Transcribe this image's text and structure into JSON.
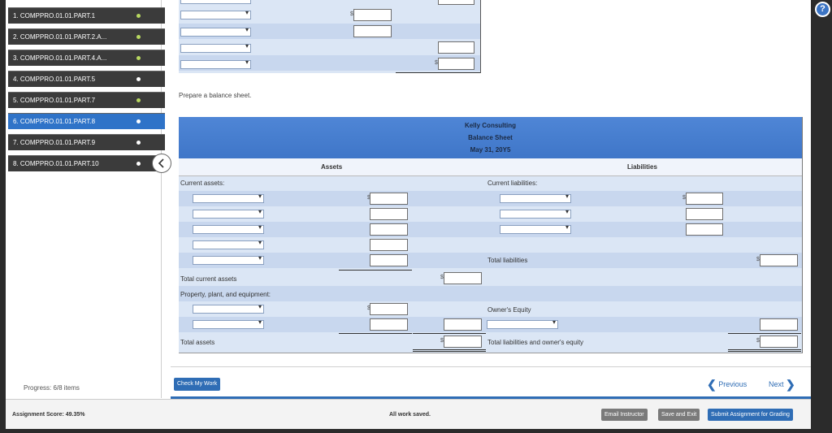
{
  "sidebar": {
    "items": [
      {
        "label": "1. COMPPRO.01.01.PART.1",
        "status": "done"
      },
      {
        "label": "2. COMPPRO.01.01.PART.2.A...",
        "status": "done"
      },
      {
        "label": "3. COMPPRO.01.01.PART.4.A...",
        "status": "done"
      },
      {
        "label": "4. COMPPRO.01.01.PART.5",
        "status": "pending"
      },
      {
        "label": "5. COMPPRO.01.01.PART.7",
        "status": "done"
      },
      {
        "label": "6. COMPPRO.01.01.PART.8",
        "status": "active"
      },
      {
        "label": "7. COMPPRO.01.01.PART.9",
        "status": "pending"
      },
      {
        "label": "8. COMPPRO.01.01.PART.10",
        "status": "pending"
      }
    ],
    "progress": "Progress:  6/8 items"
  },
  "main": {
    "instruction": "Prepare a balance sheet.",
    "balance_sheet": {
      "company": "Kelly Consulting",
      "title": "Balance Sheet",
      "date": "May 31, 20Y5",
      "assets_header": "Assets",
      "liabilities_header": "Liabilities",
      "current_assets": "Current assets:",
      "current_liabilities": "Current liabilities:",
      "total_liabilities": "Total liabilities",
      "total_current_assets": "Total current assets",
      "ppe": "Property, plant, and equipment:",
      "owners_equity": "Owner's Equity",
      "total_assets": "Total assets",
      "total_liab_equity": "Total liabilities and owner's equity",
      "currency": "$"
    },
    "check_button": "Check My Work",
    "previous": "Previous",
    "next": "Next"
  },
  "footer": {
    "score": "Assignment Score: 49.35%",
    "saved": "All work saved.",
    "email": "Email Instructor",
    "save_exit": "Save and Exit",
    "submit": "Submit Assignment for Grading"
  },
  "help": "?",
  "colors": {
    "accent": "#2f6db5",
    "header_blue": "#4f86d6",
    "row_light": "#dbe6f5",
    "row_dark": "#c8d7ee",
    "sidebar_dark": "#3b3b3b"
  }
}
